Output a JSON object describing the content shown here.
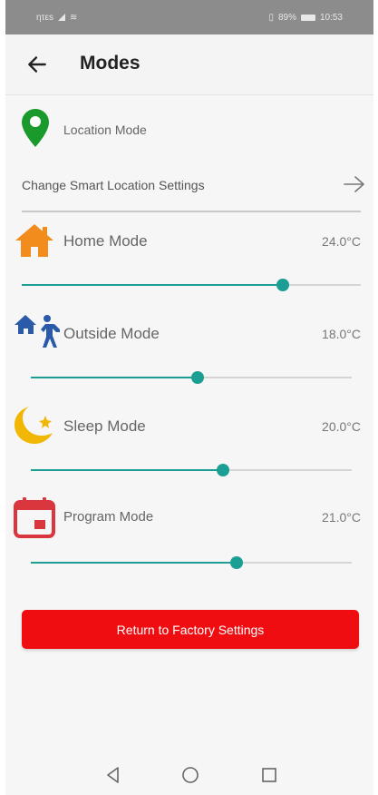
{
  "status_bar": {
    "carrier": "ητεs",
    "battery": "89%",
    "time": "10:53"
  },
  "header": {
    "title": "Modes",
    "back_icon": "arrow-left-icon"
  },
  "location": {
    "label": "Location Mode",
    "icon": "location-pin-icon",
    "icon_color": "#1a9a2a",
    "change_label": "Change Smart Location Settings",
    "change_icon": "arrow-right-icon"
  },
  "modes": [
    {
      "label": "Home Mode",
      "temperature": "24.0°C",
      "level": 0.77,
      "icon": "house-icon",
      "icon_color": "#f28c1d"
    },
    {
      "label": "Outside Mode",
      "temperature": "18.0°C",
      "level": 0.52,
      "icon": "house-walker-icon",
      "icon_color": "#2b5aa8"
    },
    {
      "label": "Sleep Mode",
      "temperature": "20.0°C",
      "level": 0.6,
      "icon": "moon-star-icon",
      "icon_color": "#f2b705"
    },
    {
      "label": "Program Mode",
      "temperature": "21.0°C",
      "level": 0.64,
      "icon": "calendar-icon",
      "icon_color": "#d9363e"
    }
  ],
  "factory_button": {
    "label": "Return to Factory Settings",
    "color": "#f00d12"
  },
  "accent_color": "#1b9e93",
  "nav_bar": {
    "back": "nav-back-icon",
    "home": "nav-home-icon",
    "recents": "nav-recents-icon"
  }
}
